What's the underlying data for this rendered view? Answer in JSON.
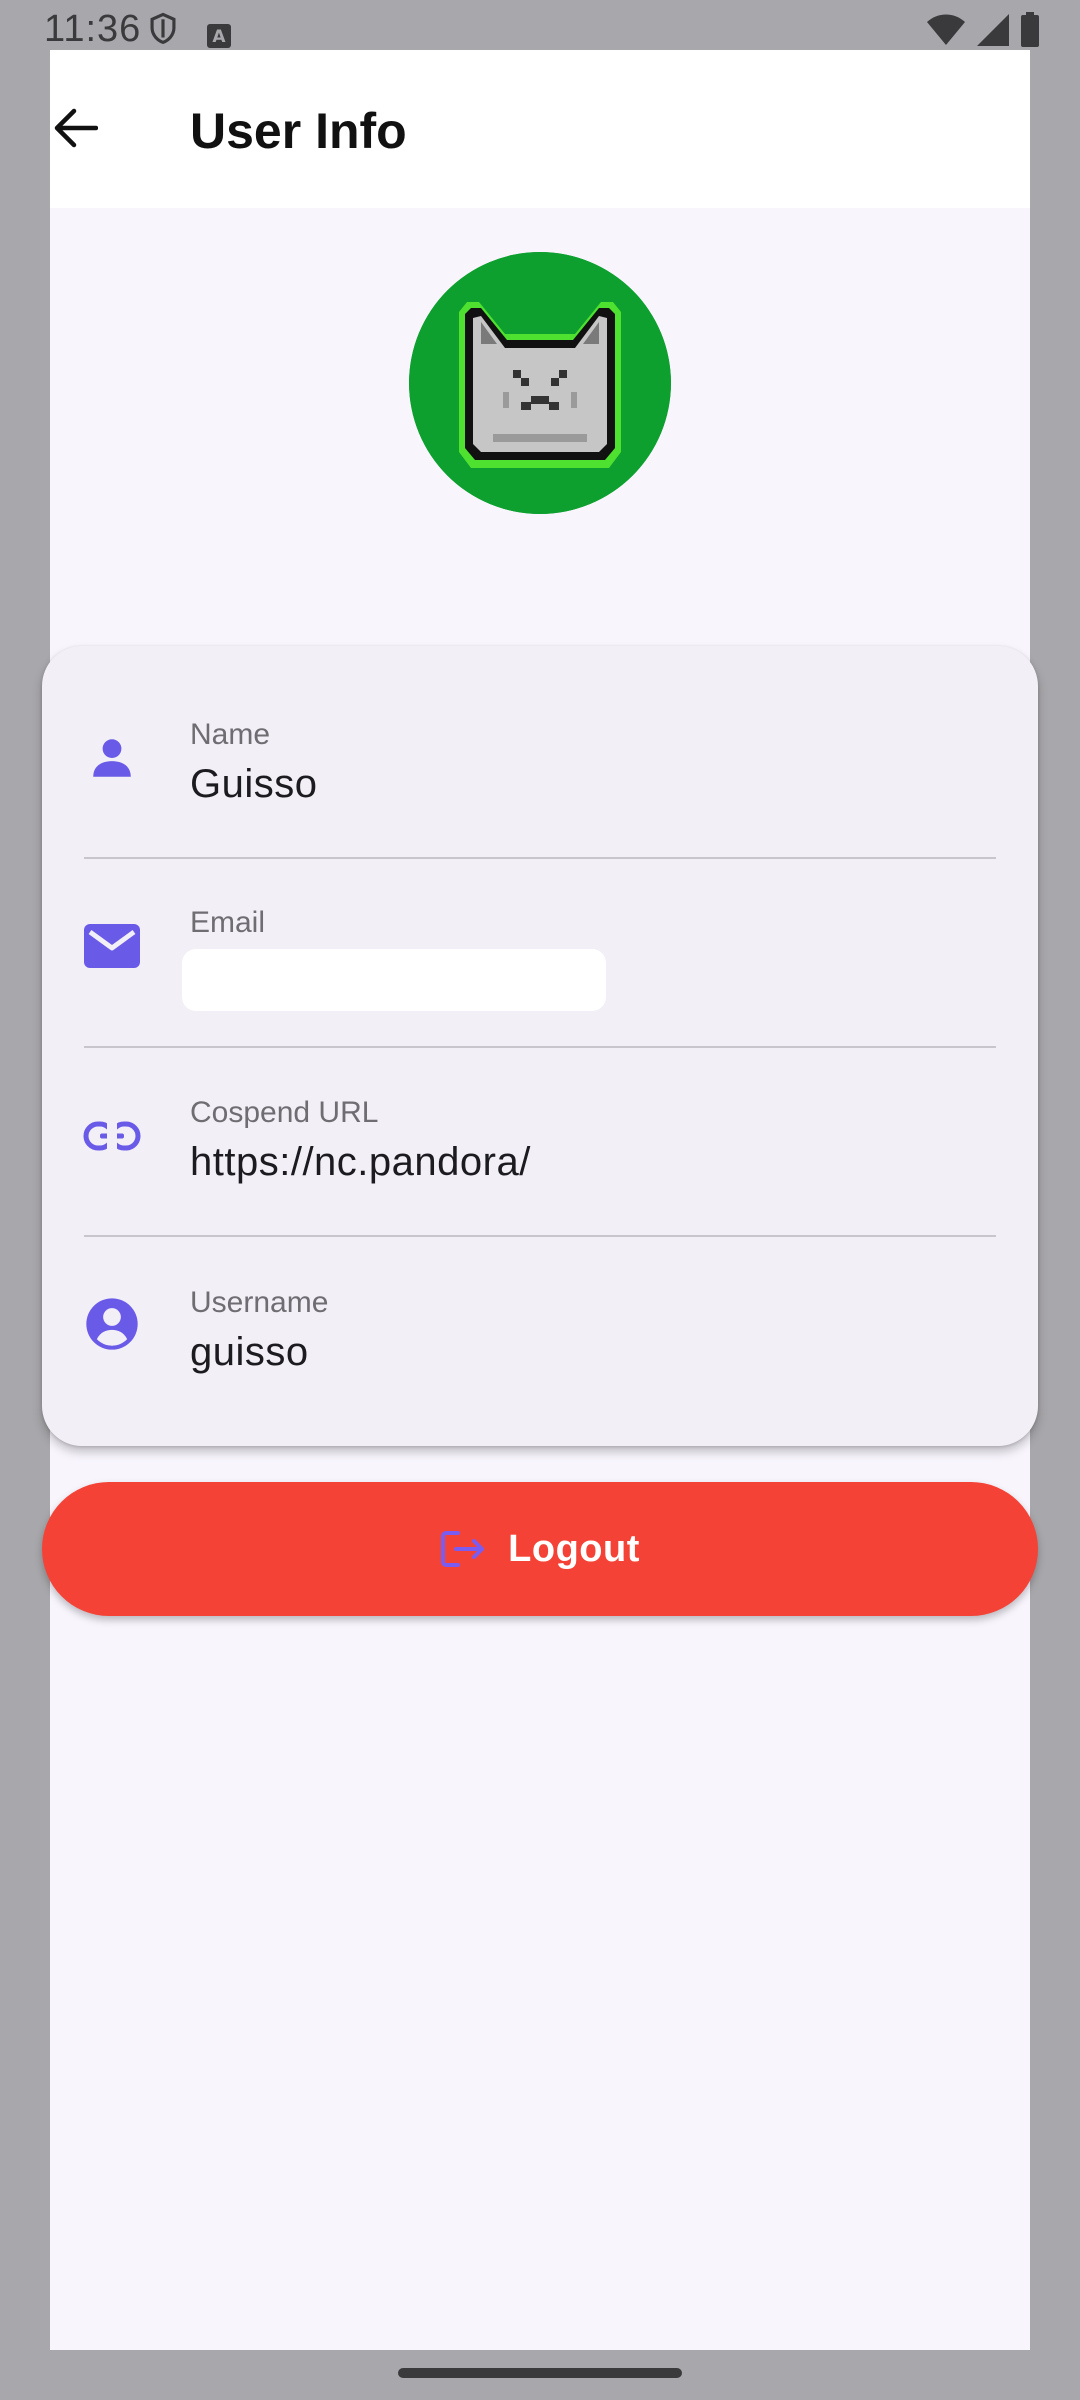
{
  "status_bar": {
    "time": "11:36",
    "a_badge": "A"
  },
  "header": {
    "title": "User Info"
  },
  "fields": [
    {
      "label": "Name",
      "value": "Guisso",
      "icon": "person-icon"
    },
    {
      "label": "Email",
      "value": "",
      "icon": "mail-icon"
    },
    {
      "label": "Cospend URL",
      "value": "https://nc.pandora/",
      "icon": "link-icon"
    },
    {
      "label": "Username",
      "value": "guisso",
      "icon": "account-circle-icon"
    }
  ],
  "logout": {
    "label": "Logout"
  },
  "colors": {
    "accent": "#6a5ae8",
    "logout_bg": "#f44336",
    "avatar_bg": "#0ea02f"
  }
}
